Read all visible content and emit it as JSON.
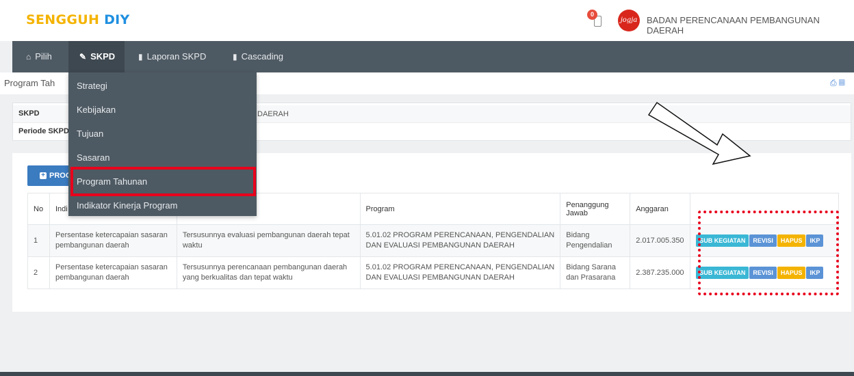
{
  "header": {
    "brand_part1": "SENGGUH",
    "brand_part2": "DIY",
    "notification_count": "0",
    "logo_text": "jogja",
    "org_name": "BADAN PERENCANAAN PEMBANGUNAN DAERAH"
  },
  "nav": {
    "items": [
      {
        "label": "Pilih",
        "icon": "home-icon"
      },
      {
        "label": "SKPD",
        "icon": "edit-icon"
      },
      {
        "label": "Laporan SKPD",
        "icon": "book-icon"
      },
      {
        "label": "Cascading",
        "icon": "book-icon"
      }
    ]
  },
  "dropdown": {
    "items": [
      "Strategi",
      "Kebijakan",
      "Tujuan",
      "Sasaran",
      "Program Tahunan",
      "Indikator Kinerja Program"
    ]
  },
  "breadcrumb": "Program Tah",
  "info": {
    "skpd_label": "SKPD",
    "skpd_value": "DAERAH",
    "periode_label": "Periode SKPD"
  },
  "add_button_label": "PROG",
  "table": {
    "headers": [
      "No",
      "Indi",
      "",
      "Program",
      "Penanggung Jawab",
      "Anggaran",
      ""
    ],
    "rows": [
      {
        "no": "1",
        "indikator": "Persentase ketercapaian sasaran pembangunan daerah",
        "sasaran": "Tersusunnya evaluasi pembangunan daerah tepat waktu",
        "program": "5.01.02 PROGRAM PERENCANAAN, PENGENDALIAN DAN EVALUASI PEMBANGUNAN DAERAH",
        "penanggung": "Bidang Pengendalian",
        "anggaran": "2.017.005.350"
      },
      {
        "no": "2",
        "indikator": "Persentase ketercapaian sasaran pembangunan daerah",
        "sasaran": "Tersusunnya perencanaan pembangunan daerah yang berkualitas dan tepat waktu",
        "program": "5.01.02 PROGRAM PERENCANAAN, PENGENDALIAN DAN EVALUASI PEMBANGUNAN DAERAH",
        "penanggung": "Bidang Sarana dan Prasarana",
        "anggaran": "2.387.235.000"
      }
    ],
    "actions": {
      "sub": "SUB KEGIATAN",
      "revisi": "REVISI",
      "hapus": "HAPUS",
      "ikp": "IKP"
    }
  },
  "colors": {
    "navbar": "#4e5a63",
    "brand_yellow": "#f4b300",
    "brand_blue": "#1f8fe0",
    "highlight_red": "#e8001c"
  }
}
